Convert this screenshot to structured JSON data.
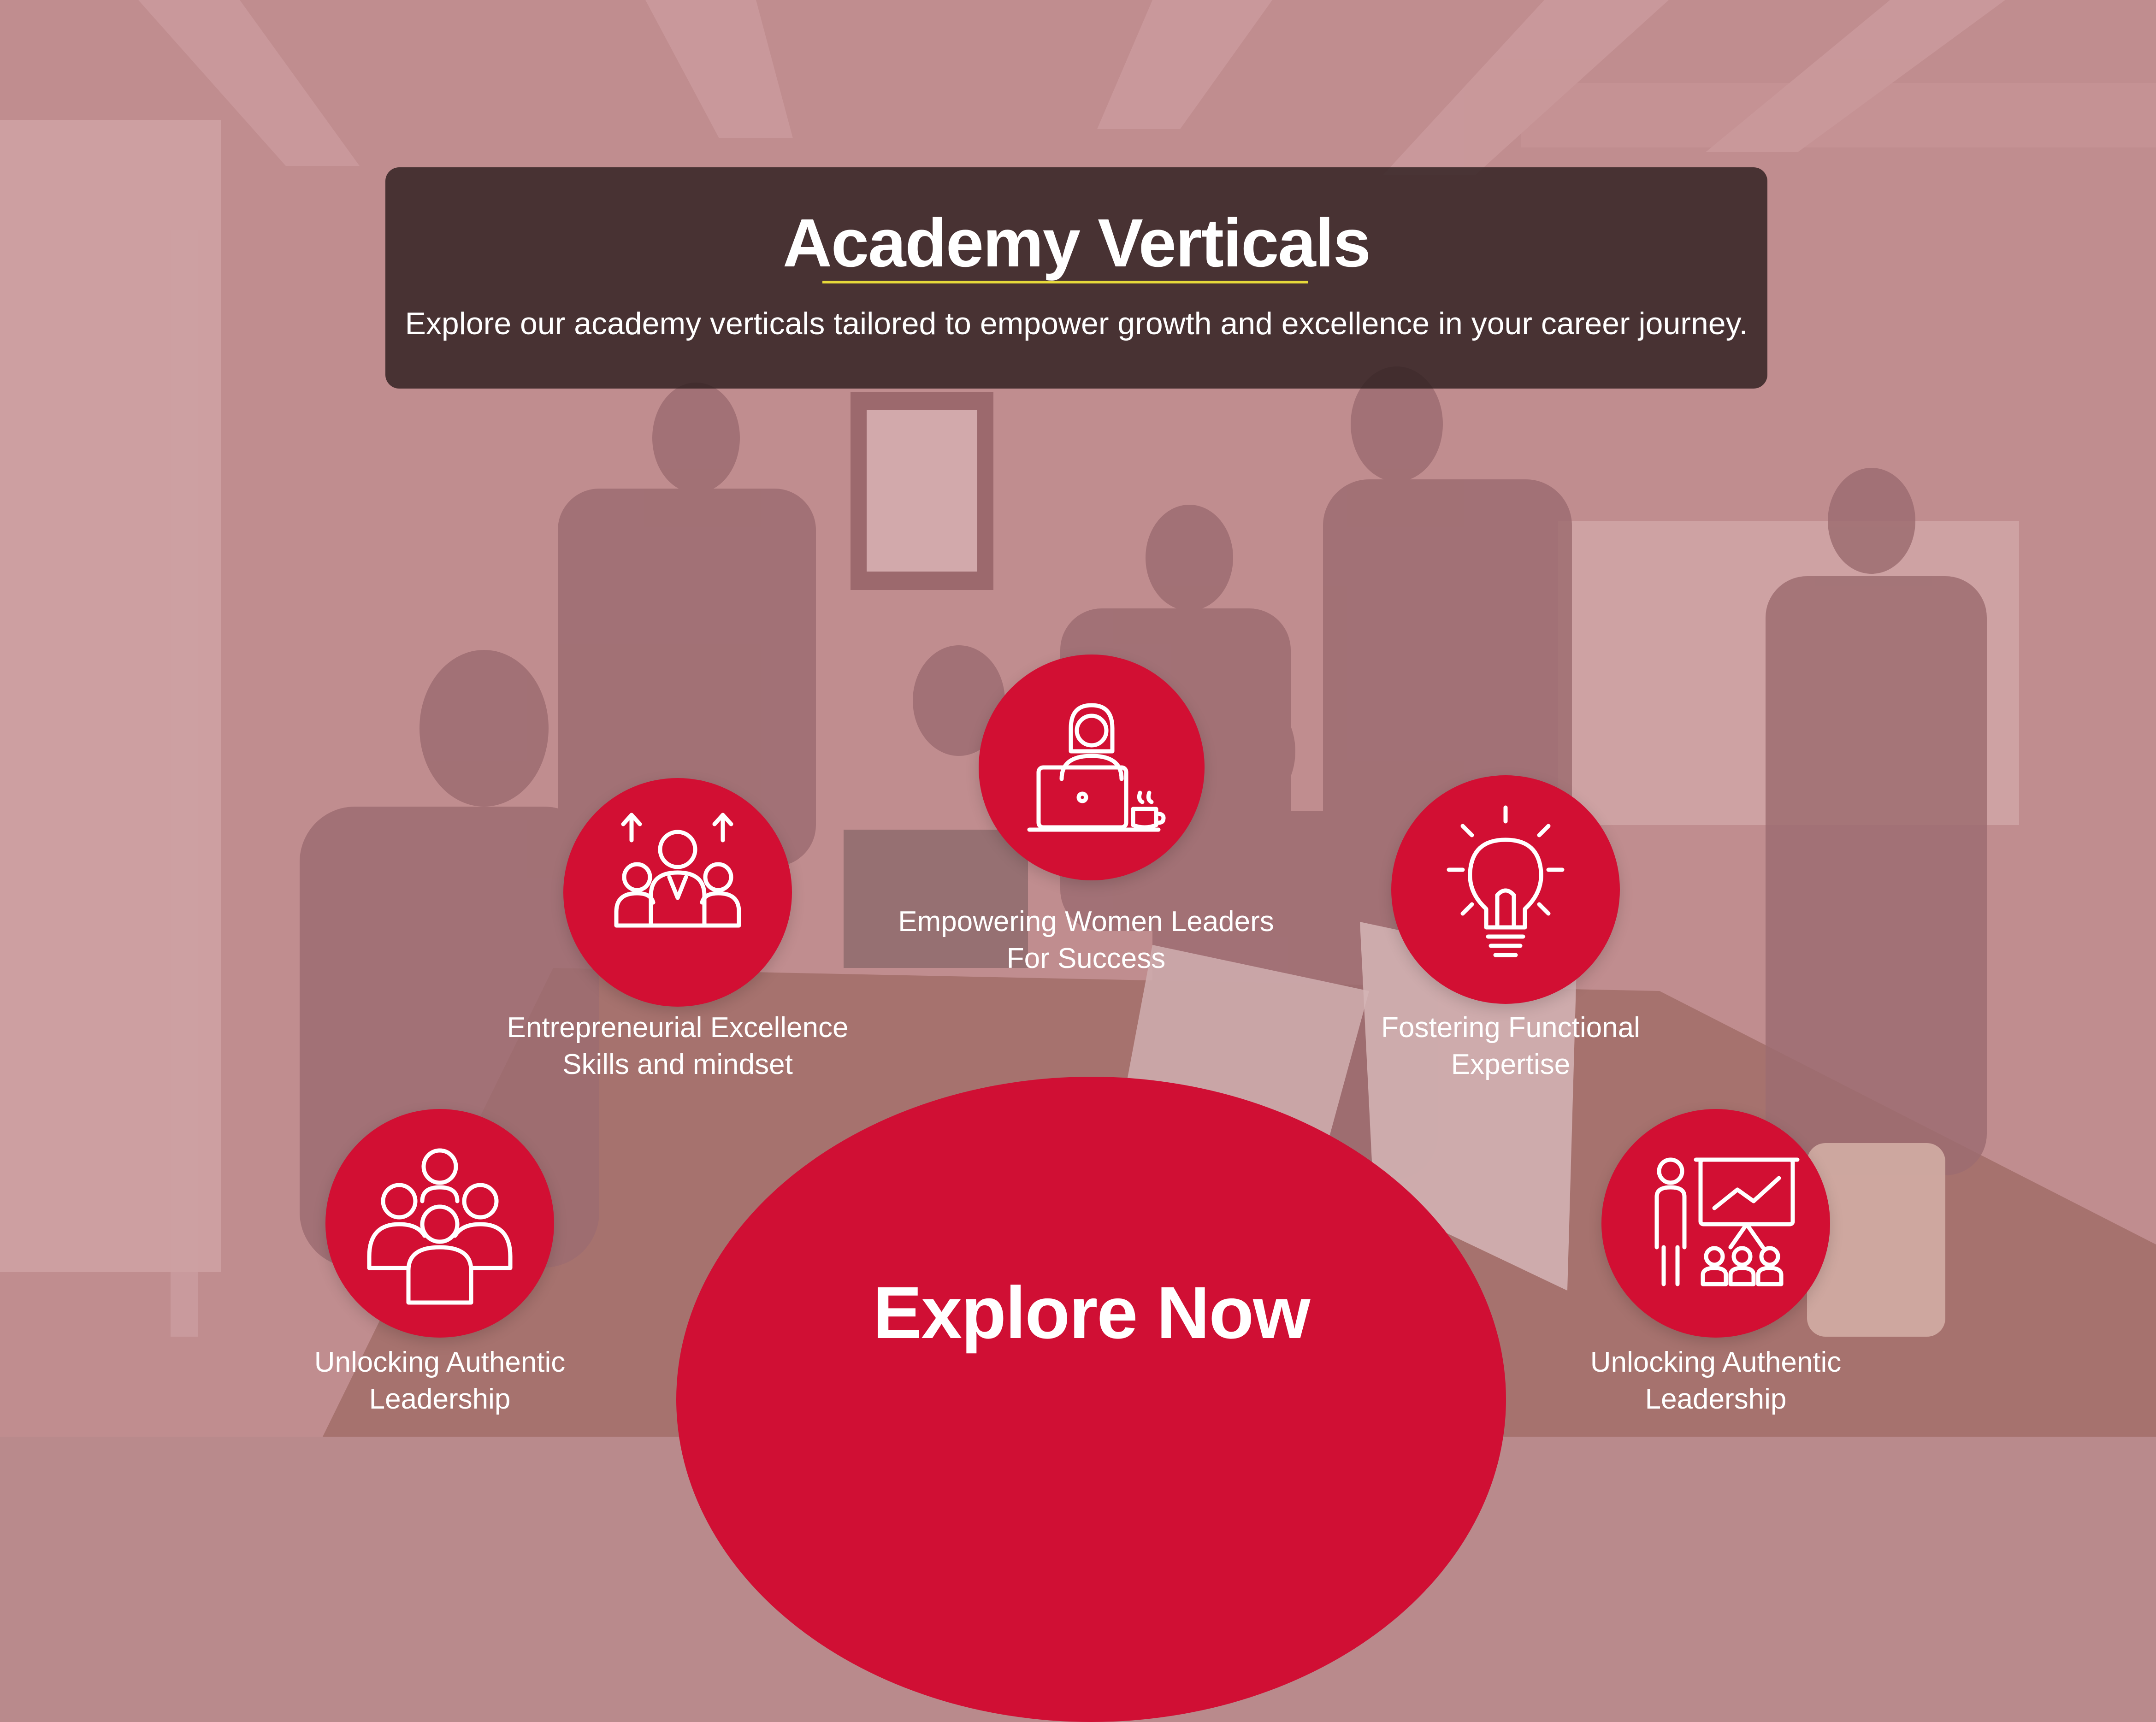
{
  "header": {
    "title": "Academy Verticals",
    "subtitle": "Explore our academy verticals tailored to empower growth and excellence in your career journey."
  },
  "verticals": [
    {
      "icon": "entrepreneur-team-icon",
      "line1": "Entrepreneurial Excellence",
      "line2": "Skills and mindset"
    },
    {
      "icon": "woman-laptop-icon",
      "line1": "Empowering Women Leaders",
      "line2": "For Success"
    },
    {
      "icon": "lightbulb-icon",
      "line1": "Fostering Functional",
      "line2": "Expertise"
    },
    {
      "icon": "group-leadership-icon",
      "line1": "Unlocking Authentic",
      "line2": "Leadership"
    },
    {
      "icon": "presentation-audience-icon",
      "line1": "Unlocking Authentic",
      "line2": "Leadership"
    }
  ],
  "cta": {
    "label": "Explore Now"
  },
  "colors": {
    "accent": "#d20f33",
    "underline": "#e6d93a",
    "overlay": "#b97f82",
    "header_bg": "#2d1e1e"
  }
}
